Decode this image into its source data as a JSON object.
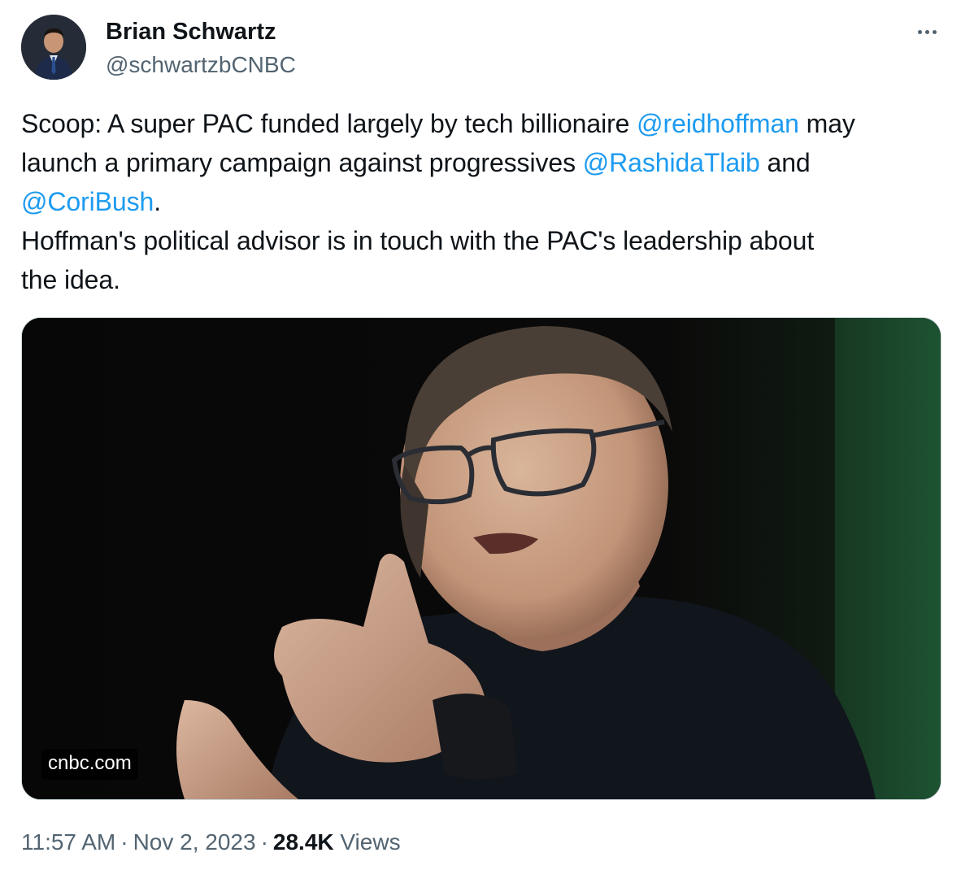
{
  "author": {
    "name": "Brian Schwartz",
    "handle": "@schwartzbCNBC"
  },
  "tweet": {
    "segments": [
      [
        {
          "type": "text",
          "text": "Scoop: A super PAC funded largely by tech billionaire "
        },
        {
          "type": "mention",
          "text": "@reidhoffman"
        },
        {
          "type": "text",
          "text": " may"
        }
      ],
      [
        {
          "type": "text",
          "text": "launch a primary campaign against progressives "
        },
        {
          "type": "mention",
          "text": "@RashidaTlaib"
        },
        {
          "type": "text",
          "text": " and"
        }
      ],
      [
        {
          "type": "mention",
          "text": "@CoriBush"
        },
        {
          "type": "text",
          "text": "."
        }
      ],
      [
        {
          "type": "text",
          "text": "Hoffman's political advisor is in touch with the PAC's leadership about"
        }
      ],
      [
        {
          "type": "text",
          "text": "the idea."
        }
      ]
    ]
  },
  "media": {
    "domain": "cnbc.com"
  },
  "meta": {
    "time": "11:57 AM",
    "separator": "·",
    "date": "Nov 2, 2023",
    "views_count": "28.4K",
    "views_label": "Views"
  },
  "icons": {
    "more": "more-horizontal-icon"
  },
  "colors": {
    "text": "#0f1419",
    "secondary": "#536471",
    "link": "#1d9bf0",
    "border": "#cfd9de"
  }
}
